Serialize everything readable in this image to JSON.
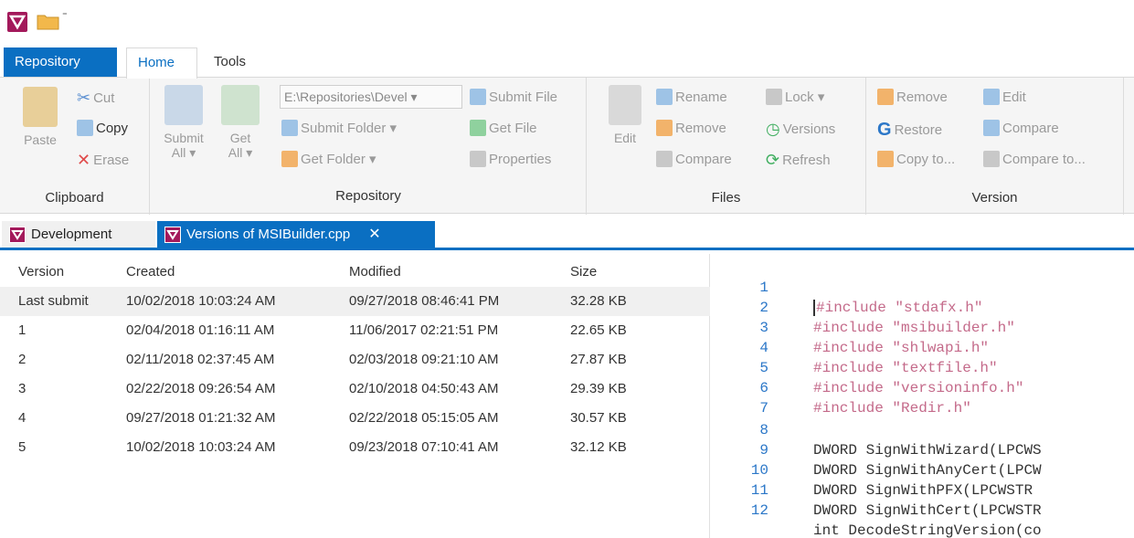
{
  "quick_access": {
    "arrow": "⁼"
  },
  "ribbon_tabs": [
    {
      "label": "Repository"
    },
    {
      "label": "Home"
    },
    {
      "label": "Tools"
    }
  ],
  "clipboard": {
    "cut": "Cut",
    "copy": "Copy",
    "paste": "Paste",
    "erase": "Erase",
    "label": "Clipboard"
  },
  "repository_group": {
    "submit_all": "Submit",
    "submit_all_2": "All ▾",
    "get_all": "Get",
    "get_all_2": "All ▾",
    "path": "E:\\Repositories\\Devel ▾",
    "submit_folder": "Submit Folder ▾",
    "get_folder": "Get Folder ▾",
    "submit_file": "Submit File",
    "get_file": "Get File",
    "properties": "Properties",
    "label": "Repository"
  },
  "files_group": {
    "edit": "Edit",
    "rename": "Rename",
    "remove": "Remove",
    "compare": "Compare",
    "lock": "Lock ▾",
    "versions": "Versions",
    "refresh": "Refresh",
    "label": "Files"
  },
  "version_group": {
    "remove": "Remove",
    "restore": "Restore",
    "copy_to": "Copy to...",
    "edit": "Edit",
    "compare": "Compare",
    "compare_to": "Compare to...",
    "label": "Version"
  },
  "doc_tabs": [
    {
      "label": "Development"
    },
    {
      "label": "Versions of MSIBuilder.cpp",
      "close": "✕"
    }
  ],
  "table": {
    "headers": [
      "Version",
      "Created",
      "Modified",
      "Size"
    ],
    "rows": [
      [
        "Last submit",
        "10/02/2018 10:03:24 AM",
        "09/27/2018 08:46:41 PM",
        "32.28 KB"
      ],
      [
        "1",
        "02/04/2018 01:16:11 AM",
        "11/06/2017 02:21:51 PM",
        "22.65 KB"
      ],
      [
        "2",
        "02/11/2018 02:37:45 AM",
        "02/03/2018 09:21:10 AM",
        "27.87 KB"
      ],
      [
        "3",
        "02/22/2018 09:26:54 AM",
        "02/10/2018 04:50:43 AM",
        "29.39 KB"
      ],
      [
        "4",
        "09/27/2018 01:21:32 AM",
        "02/22/2018 05:15:05 AM",
        "30.57 KB"
      ],
      [
        "5",
        "10/02/2018 10:03:24 AM",
        "09/23/2018 07:10:41 AM",
        "32.12 KB"
      ]
    ]
  },
  "code": [
    {
      "n": "1",
      "text": "#include \"stdafx.h\"",
      "pre": true
    },
    {
      "n": "2",
      "text": "#include \"msibuilder.h\"",
      "pre": true
    },
    {
      "n": "3",
      "text": "#include \"shlwapi.h\"",
      "pre": true
    },
    {
      "n": "4",
      "text": "#include \"textfile.h\"",
      "pre": true
    },
    {
      "n": "5",
      "text": "#include \"versioninfo.h\"",
      "pre": true
    },
    {
      "n": "6",
      "text": "#include \"Redir.h\"",
      "pre": true
    },
    {
      "n": "7",
      "text": "",
      "pre": false
    },
    {
      "n": "8",
      "text": "DWORD SignWithWizard(LPCWS",
      "pre": false
    },
    {
      "n": "9",
      "text": "DWORD SignWithAnyCert(LPCW",
      "pre": false
    },
    {
      "n": "10",
      "text": "DWORD SignWithPFX(LPCWSTR",
      "pre": false
    },
    {
      "n": "11",
      "text": "DWORD SignWithCert(LPCWSTR",
      "pre": false
    },
    {
      "n": "12",
      "text": "int DecodeStringVersion(co",
      "pre": false
    }
  ]
}
